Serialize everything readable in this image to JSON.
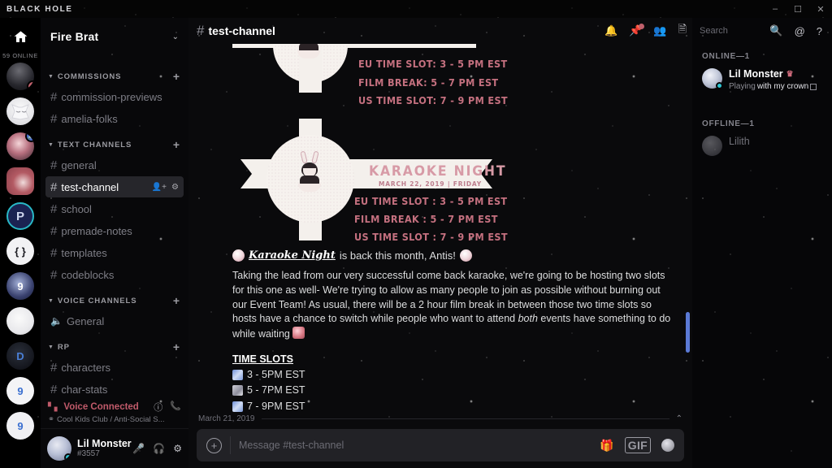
{
  "titlebar": {
    "brand": "BLACK HOLE",
    "minimize": "–",
    "maximize": "☐",
    "close": "✕"
  },
  "guild_rail": {
    "home_icon": "home-icon",
    "online_count": "59 ONLINE",
    "servers": [
      {
        "name": "server-avatar-1",
        "badge": "4",
        "pill": false,
        "mute": false,
        "shape": "circle",
        "style": "a"
      },
      {
        "name": "server-avatar-2",
        "badge": "",
        "pill": false,
        "mute": false,
        "shape": "circle",
        "style": "b"
      },
      {
        "name": "server-avatar-3",
        "badge": "",
        "pill": true,
        "mute": true,
        "shape": "circle",
        "style": "c"
      },
      {
        "name": "server-avatar-4",
        "badge": "",
        "pill": true,
        "mute": false,
        "shape": "square",
        "style": "d"
      },
      {
        "name": "server-avatar-5",
        "badge": "",
        "pill": false,
        "mute": false,
        "shape": "circle",
        "style": "e",
        "label": "P"
      },
      {
        "name": "server-avatar-6",
        "badge": "",
        "pill": false,
        "mute": false,
        "shape": "circle",
        "style": "f",
        "label": "{ }"
      },
      {
        "name": "server-avatar-7",
        "badge": "",
        "pill": true,
        "mute": false,
        "shape": "circle",
        "style": "g",
        "label": "9"
      },
      {
        "name": "server-avatar-8",
        "badge": "",
        "pill": false,
        "mute": false,
        "shape": "circle",
        "style": "h"
      },
      {
        "name": "server-avatar-9",
        "badge": "",
        "pill": true,
        "mute": false,
        "shape": "circle",
        "style": "i",
        "label": "D"
      },
      {
        "name": "server-avatar-10",
        "badge": "",
        "pill": true,
        "mute": false,
        "shape": "circle",
        "style": "j",
        "label": "9"
      },
      {
        "name": "server-avatar-11",
        "badge": "",
        "pill": false,
        "mute": false,
        "shape": "circle",
        "style": "k",
        "label": "9"
      }
    ]
  },
  "sidebar": {
    "server_name": "Fire Brat",
    "chevron": "⌄",
    "categories": [
      {
        "label": "COMMISSIONS",
        "channels": [
          {
            "name": "commission-previews",
            "type": "text",
            "active": false
          },
          {
            "name": "amelia-folks",
            "type": "text",
            "active": false
          }
        ]
      },
      {
        "label": "TEXT CHANNELS",
        "channels": [
          {
            "name": "general",
            "type": "text",
            "active": false
          },
          {
            "name": "test-channel",
            "type": "text",
            "active": true
          },
          {
            "name": "school",
            "type": "text",
            "active": false
          },
          {
            "name": "premade-notes",
            "type": "text",
            "active": false
          },
          {
            "name": "templates",
            "type": "text",
            "active": false
          },
          {
            "name": "codeblocks",
            "type": "text",
            "active": false
          }
        ]
      },
      {
        "label": "VOICE CHANNELS",
        "channels": [
          {
            "name": "General",
            "type": "voice",
            "active": false
          }
        ]
      },
      {
        "label": "RP",
        "channels": [
          {
            "name": "characters",
            "type": "text",
            "active": false
          },
          {
            "name": "char-stats",
            "type": "text",
            "active": false
          }
        ]
      }
    ],
    "add_channel_icon": "plus-icon"
  },
  "voice_panel": {
    "status": "Voice Connected",
    "server_path": "Cool Kids Club / Anti-Social S...",
    "info_icon": "info-icon",
    "disconnect_icon": "disconnect-call-icon",
    "signal_icon": "signal-bars-icon"
  },
  "user_panel": {
    "username": "Lil Monster",
    "discriminator": "#3557",
    "mic_icon": "microphone-icon",
    "headphones_icon": "headphones-icon",
    "settings_icon": "gear-icon"
  },
  "channel_header": {
    "hash": "#",
    "name": "test-channel"
  },
  "toolbar": {
    "bell_icon": "bell-icon",
    "pin_icon": "pin-icon",
    "members_icon": "members-icon",
    "inbox_icon": "inbox-icon",
    "search_placeholder": "Search",
    "search_icon": "magnifier-icon",
    "mentions_icon": "at-mention-icon",
    "help_icon": "help-icon"
  },
  "flyer": {
    "card_top": {
      "lines": [
        "EU TIME SLOT: 3 - 5 PM EST",
        "FILM BREAK: 5 - 7 PM EST",
        "US TIME SLOT: 7 - 9 PM EST"
      ]
    },
    "card_bottom": {
      "title": "KARAOKE NIGHT",
      "subtitle": "MARCH 22, 2019 | FRIDAY",
      "lines": [
        "EU TIME SLOT : 3 - 5 PM EST",
        "FILM BREAK : 5 - 7 PM EST",
        "US TIME SLOT : 7 - 9 PM EST"
      ]
    }
  },
  "message": {
    "headline_keyword": "Karaoke Night",
    "headline_rest": "is back this month, Antis!",
    "paragraph_1": "Taking the lead from our very successful come back karaoke, we're going to be hosting two slots for this one as well- We're trying to allow as many people to join as possible without burning out our Event Team! As usual, there will be a 2 hour film break in between those two time slots so hosts have a chance to switch while people who want to attend ",
    "paragraph_em": "both",
    "paragraph_2": " events have something to do while waiting",
    "time_slots_title": "TIME SLOTS",
    "time_slots": [
      {
        "icon": "confetti-icon",
        "label": "3 - 5PM EST"
      },
      {
        "icon": "film-icon",
        "label": "5 - 7PM EST"
      },
      {
        "icon": "confetti-icon",
        "label": "7 - 9PM EST"
      }
    ]
  },
  "date_divider": {
    "label": "March 21, 2019",
    "jump_icon": "⌃"
  },
  "composer": {
    "placeholder": "Message #test-channel",
    "upload_icon": "plus-circle-icon",
    "gift_icon": "gift-icon",
    "gif_label": "GIF",
    "emoji_icon": "emoji-icon"
  },
  "members": {
    "online_label": "ONLINE—1",
    "offline_label": "OFFLINE—1",
    "online": [
      {
        "name": "Lil Monster",
        "crown": "♛",
        "activity_prefix": "Playing",
        "activity_highlight": "with my crown"
      }
    ],
    "offline": [
      {
        "name": "Lilith"
      }
    ]
  },
  "colors": {
    "accent_red": "#c0606c",
    "scrollbar_blue": "#5b7ad6",
    "flyer_pink": "#c4707f",
    "flyer_title_pink": "#d79aa6",
    "status_teal": "#2ec7d4",
    "active_channel_bg": "#26262b"
  }
}
